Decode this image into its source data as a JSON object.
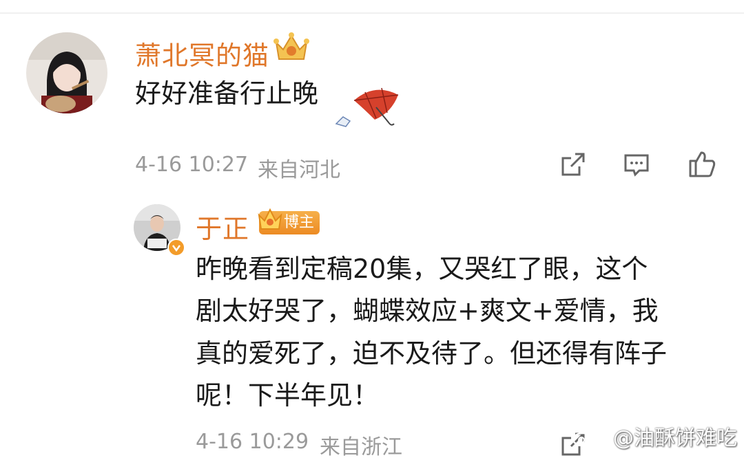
{
  "comments": [
    {
      "username": "萧北冥的猫",
      "text": "好好准备行止晚",
      "date": "4-16 10:27",
      "location": "来自河北"
    },
    {
      "username": "于正",
      "badge": "博主",
      "lines": [
        "昨晚看到定稿20集，又哭红了眼，这个",
        "剧太好哭了，蝴蝶效应+爽文+爱情，我",
        "真的爱死了，迫不及待了。但还得有阵子",
        "呢！下半年见！"
      ],
      "date": "4-16 10:29",
      "location": "来自浙江"
    }
  ],
  "watermark": "@油酥饼难吃",
  "icons": [
    "share-icon",
    "comment-icon",
    "like-icon",
    "crown-icon",
    "umbrella-icon",
    "verified-icon",
    "weibo-logo-icon"
  ],
  "colors": {
    "username": "#e0772a",
    "meta": "#9a9a9a",
    "badge": "#ec8a23"
  }
}
